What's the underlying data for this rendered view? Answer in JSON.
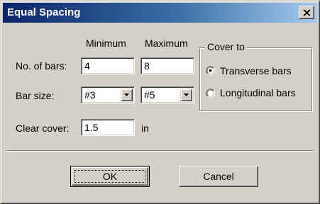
{
  "window": {
    "title": "Equal Spacing",
    "close_icon": "close-icon"
  },
  "columns": {
    "minimum": "Minimum",
    "maximum": "Maximum"
  },
  "bars": {
    "label": "No. of bars:",
    "min_value": "4",
    "max_value": "8"
  },
  "bar_size": {
    "label": "Bar size:",
    "min_value": "#3",
    "max_value": "#5"
  },
  "clear_cover": {
    "label": "Clear cover:",
    "value": "1.5",
    "unit": "in"
  },
  "cover_to": {
    "title": "Cover to",
    "options": [
      {
        "label": "Transverse bars",
        "selected": true
      },
      {
        "label": "Longitudinal bars",
        "selected": false
      }
    ]
  },
  "buttons": {
    "ok": "OK",
    "cancel": "Cancel"
  },
  "colors": {
    "title_gradient_start": "#0a246a",
    "title_gradient_end": "#a6caf0",
    "face": "#d4d0c8"
  }
}
